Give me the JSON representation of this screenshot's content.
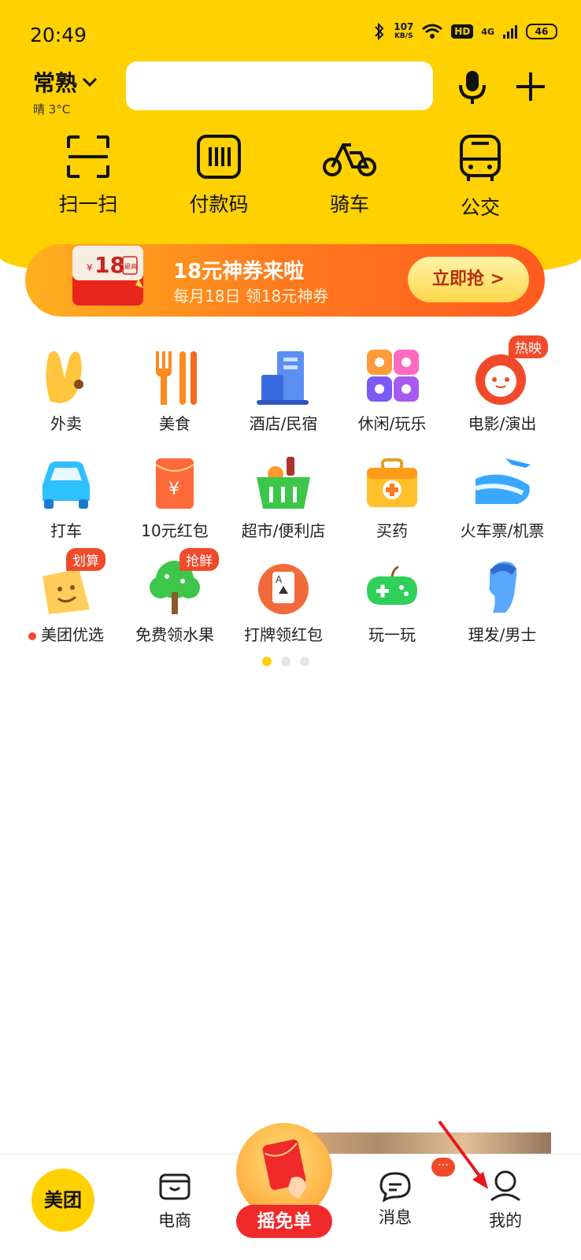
{
  "status_bar": {
    "time": "20:49",
    "net_speed": "107",
    "net_unit": "KB/S",
    "hd": "HD",
    "signal": "4G",
    "battery": "46"
  },
  "header": {
    "city": "常熟",
    "weather": "晴 3°C"
  },
  "quick_actions": [
    {
      "label": "扫一扫",
      "icon": "scan-icon"
    },
    {
      "label": "付款码",
      "icon": "barcode-icon"
    },
    {
      "label": "骑车",
      "icon": "bike-icon"
    },
    {
      "label": "公交",
      "icon": "bus-icon"
    }
  ],
  "promo": {
    "envelope_value": "18",
    "envelope_tag": "最高",
    "title": "18元神券来啦",
    "subtitle": "每月18日 领18元神券",
    "button": "立即抢 >"
  },
  "categories": [
    {
      "label": "外卖",
      "icon": "takeout-icon"
    },
    {
      "label": "美食",
      "icon": "fork-icon"
    },
    {
      "label": "酒店/民宿",
      "icon": "hotel-icon"
    },
    {
      "label": "休闲/玩乐",
      "icon": "leisure-icon"
    },
    {
      "label": "电影/演出",
      "icon": "movie-cat-icon",
      "badge": "热映"
    },
    {
      "label": "打车",
      "icon": "car-icon"
    },
    {
      "label": "10元红包",
      "icon": "red-envelope-icon"
    },
    {
      "label": "超市/便利店",
      "icon": "basket-icon"
    },
    {
      "label": "买药",
      "icon": "medicine-icon"
    },
    {
      "label": "火车票/机票",
      "icon": "train-plane-icon"
    },
    {
      "label": "美团优选",
      "icon": "smile-cheese-icon",
      "badge": "划算",
      "dot": true
    },
    {
      "label": "免费领水果",
      "icon": "tree-icon",
      "badge": "抢鲜"
    },
    {
      "label": "打牌领红包",
      "icon": "card-icon"
    },
    {
      "label": "玩一玩",
      "icon": "gamepad-icon"
    },
    {
      "label": "理发/男士",
      "icon": "head-icon"
    }
  ],
  "pager": {
    "pages": 3,
    "active": 0
  },
  "tab_bar": {
    "home": "美团",
    "ecommerce": "电商",
    "shake": "摇免单",
    "messages": "消息",
    "message_badge": "···",
    "mine": "我的"
  },
  "colors": {
    "brand_yellow": "#ffd100",
    "accent_red": "#f04a2a",
    "promo_orange": "#ff7a1e"
  }
}
